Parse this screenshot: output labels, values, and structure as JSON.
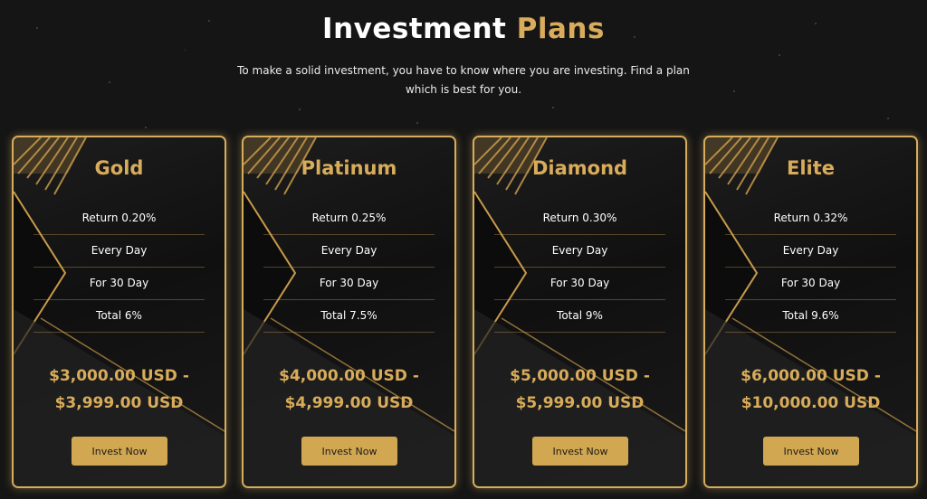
{
  "header": {
    "title_main": "Investment",
    "title_accent": "Plans",
    "subtitle": "To make a solid investment, you have to know where you are investing. Find a plan which is best for you."
  },
  "plans": [
    {
      "name": "Gold",
      "return": "Return 0.20%",
      "frequency": "Every Day",
      "duration": "For 30 Day",
      "total": "Total 6%",
      "price_from": "$3,000.00 USD -",
      "price_to": "$3,999.00 USD",
      "button": "Invest Now"
    },
    {
      "name": "Platinum",
      "return": "Return 0.25%",
      "frequency": "Every Day",
      "duration": "For 30 Day",
      "total": "Total 7.5%",
      "price_from": "$4,000.00 USD -",
      "price_to": "$4,999.00 USD",
      "button": "Invest Now"
    },
    {
      "name": "Diamond",
      "return": "Return 0.30%",
      "frequency": "Every Day",
      "duration": "For 30 Day",
      "total": "Total 9%",
      "price_from": "$5,000.00 USD -",
      "price_to": "$5,999.00 USD",
      "button": "Invest Now"
    },
    {
      "name": "Elite",
      "return": "Return 0.32%",
      "frequency": "Every Day",
      "duration": "For 30 Day",
      "total": "Total 9.6%",
      "price_from": "$6,000.00 USD -",
      "price_to": "$10,000.00 USD",
      "button": "Invest Now"
    }
  ],
  "colors": {
    "accent": "#d8ac5a",
    "background": "#151515",
    "text": "#ffffff"
  }
}
